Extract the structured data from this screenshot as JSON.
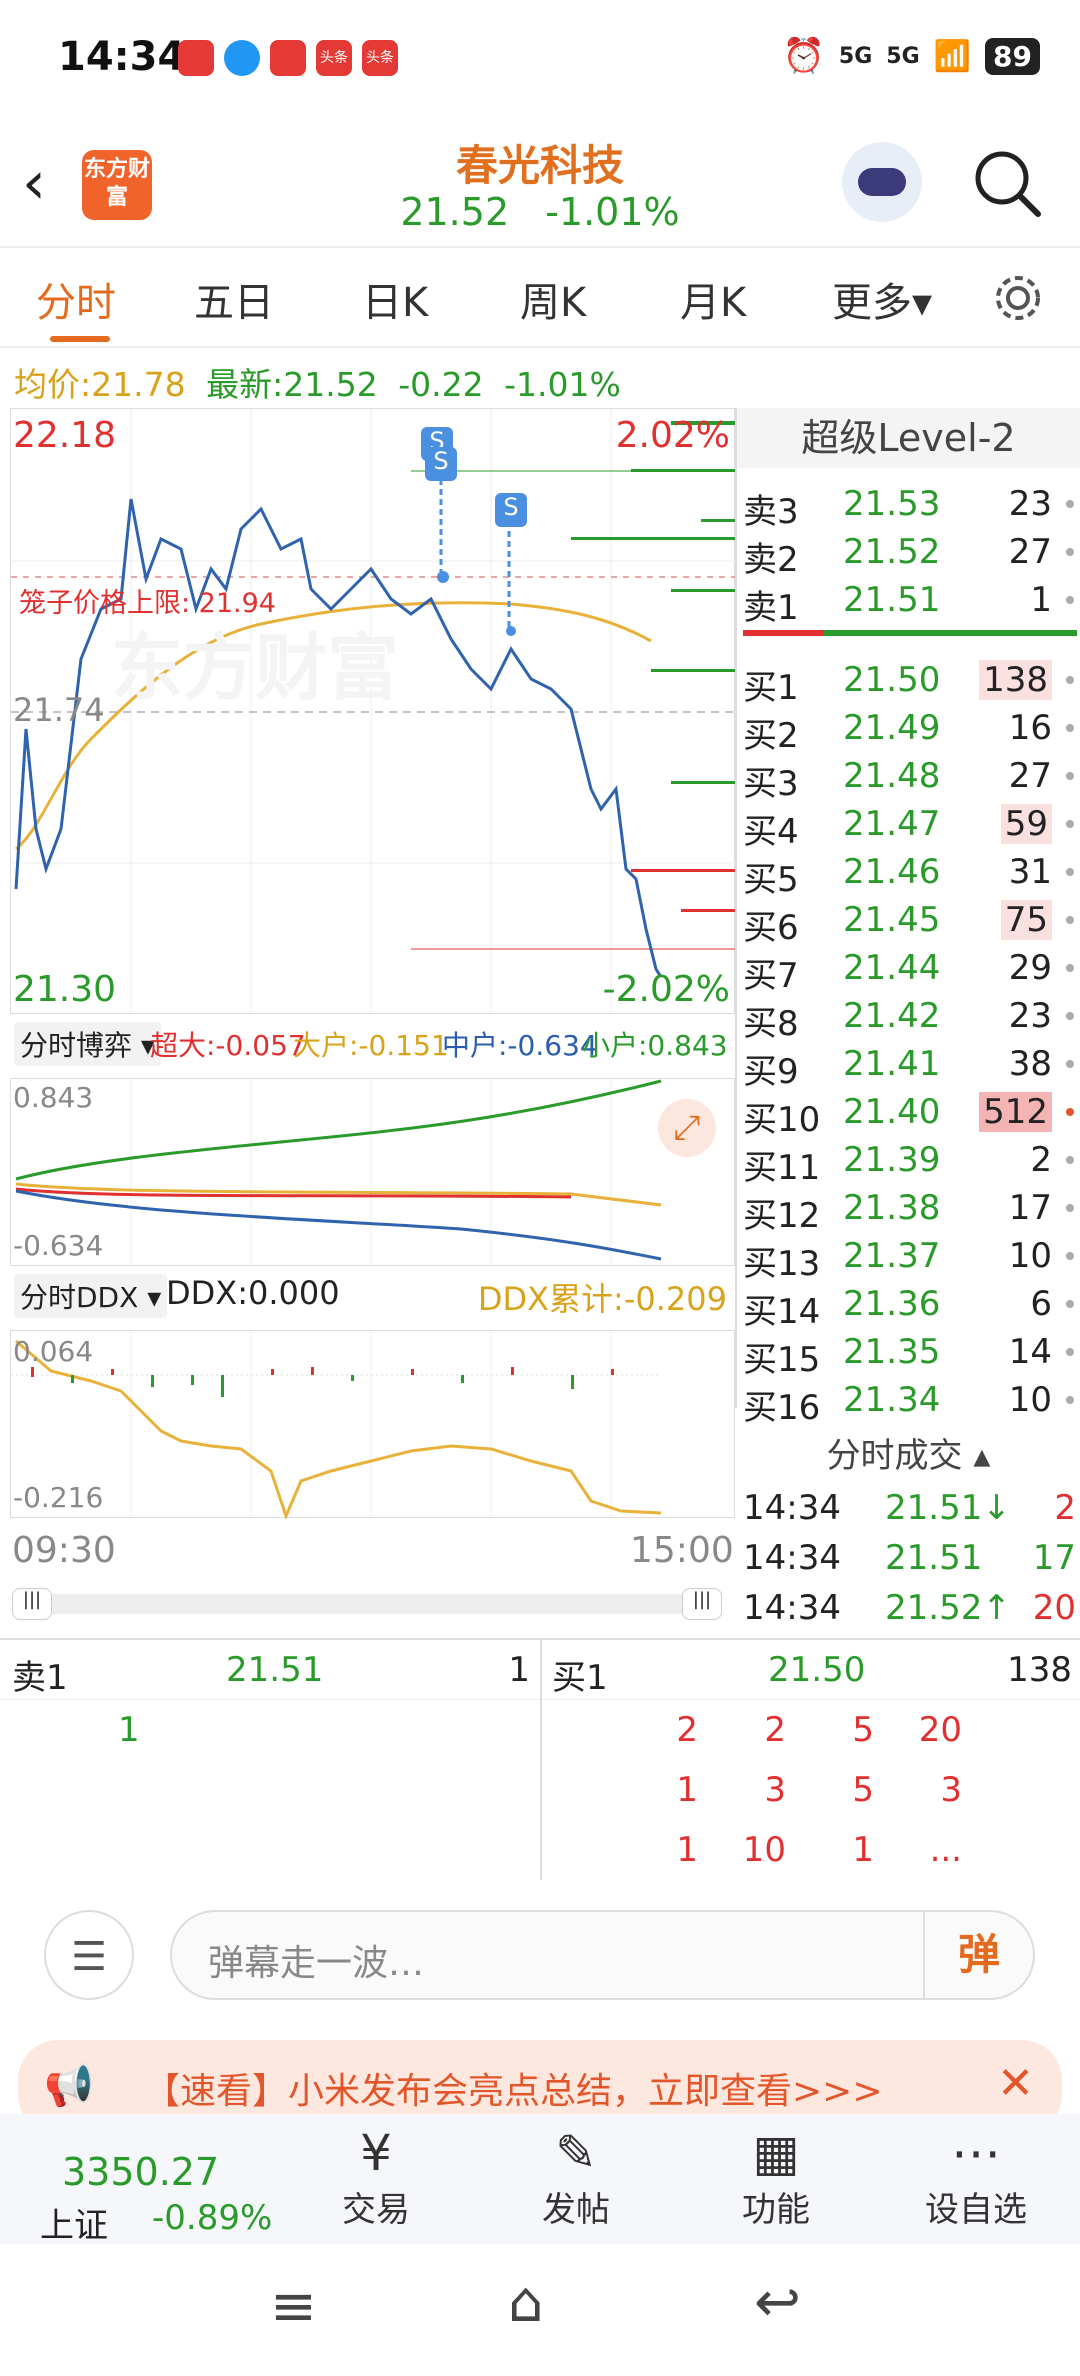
{
  "status_bar": {
    "time": "14:34",
    "signal1": "5G",
    "signal2": "5G",
    "battery": "89"
  },
  "header": {
    "logo_text": "东方财富",
    "stock_name": "春光科技",
    "price": "21.52",
    "change_pct": "-1.01%"
  },
  "tabs": [
    "分时",
    "五日",
    "日K",
    "周K",
    "月K",
    "更多▾"
  ],
  "info": {
    "avg_label": "均价:",
    "avg_value": "21.78",
    "latest_label": "最新:",
    "latest_value": "21.52",
    "change": "-0.22",
    "change_pct": "-1.01%"
  },
  "chart": {
    "y_high": "22.18",
    "y_low": "21.30",
    "pct_high": "2.02%",
    "pct_low": "-2.02%",
    "pre_close": "21.74",
    "cage_label": "笼子价格上限: 21.94",
    "watermark": "东方财富",
    "time_start": "09:30",
    "time_end": "15:00",
    "marker": "S"
  },
  "fund_panel": {
    "selector": "分时博弈",
    "super": "超大:-0.057",
    "big": "大户:-0.151",
    "mid": "中户:-0.634",
    "small": "小户:0.843",
    "top": "0.843",
    "bottom": "-0.634"
  },
  "ddx_panel": {
    "selector": "分时DDX",
    "ddx": "DDX:0.000",
    "ddx_sum": "DDX累计:-0.209",
    "top": "0.064",
    "bottom": "-0.216"
  },
  "book": {
    "title": "超级Level-2",
    "asks": [
      {
        "label": "卖3",
        "price": "21.53",
        "vol": "23"
      },
      {
        "label": "卖2",
        "price": "21.52",
        "vol": "27"
      },
      {
        "label": "卖1",
        "price": "21.51",
        "vol": "1"
      }
    ],
    "bids": [
      {
        "label": "买1",
        "price": "21.50",
        "vol": "138"
      },
      {
        "label": "买2",
        "price": "21.49",
        "vol": "16"
      },
      {
        "label": "买3",
        "price": "21.48",
        "vol": "27"
      },
      {
        "label": "买4",
        "price": "21.47",
        "vol": "59"
      },
      {
        "label": "买5",
        "price": "21.46",
        "vol": "31"
      },
      {
        "label": "买6",
        "price": "21.45",
        "vol": "75"
      },
      {
        "label": "买7",
        "price": "21.44",
        "vol": "29"
      },
      {
        "label": "买8",
        "price": "21.42",
        "vol": "23"
      },
      {
        "label": "买9",
        "price": "21.41",
        "vol": "38"
      },
      {
        "label": "买10",
        "price": "21.40",
        "vol": "512"
      },
      {
        "label": "买11",
        "price": "21.39",
        "vol": "2"
      },
      {
        "label": "买12",
        "price": "21.38",
        "vol": "17"
      },
      {
        "label": "买13",
        "price": "21.37",
        "vol": "10"
      },
      {
        "label": "买14",
        "price": "21.36",
        "vol": "6"
      },
      {
        "label": "买15",
        "price": "21.35",
        "vol": "14"
      },
      {
        "label": "买16",
        "price": "21.34",
        "vol": "10"
      }
    ],
    "trades_title": "分时成交",
    "trades": [
      {
        "time": "14:34",
        "price": "21.51↓",
        "vol": "2"
      },
      {
        "time": "14:34",
        "price": "21.51",
        "vol": "17"
      },
      {
        "time": "14:34",
        "price": "21.52↑",
        "vol": "20"
      }
    ]
  },
  "queue": {
    "sell_label": "卖1",
    "sell_price": "21.51",
    "sell_vol": "1",
    "sell_orders": [
      "1"
    ],
    "buy_label": "买1",
    "buy_price": "21.50",
    "buy_vol": "138",
    "buy_orders": [
      [
        "2",
        "2",
        "5",
        "20"
      ],
      [
        "1",
        "3",
        "5",
        "3"
      ],
      [
        "1",
        "10",
        "1",
        "..."
      ]
    ]
  },
  "danmu": {
    "placeholder": "弹幕走一波…",
    "button": "弹"
  },
  "ad": {
    "text": "【速看】小米发布会亮点总结，立即查看>>>"
  },
  "nav": {
    "index_value": "3350.27",
    "index_name": "上证",
    "index_change": "-0.89%",
    "items": [
      "交易",
      "发帖",
      "功能",
      "设自选"
    ]
  }
}
